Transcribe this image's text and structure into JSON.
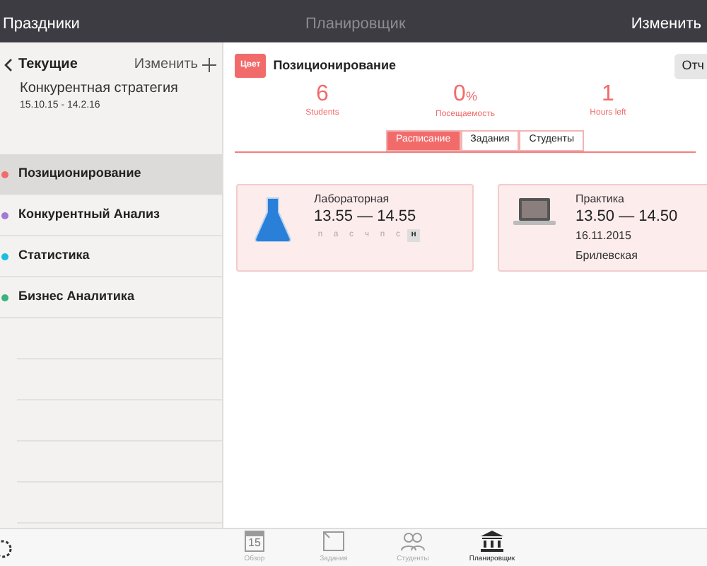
{
  "navbar": {
    "left": "Праздники",
    "title": "Планировщик",
    "right": "Изменить"
  },
  "sidebar": {
    "header": {
      "title": "Текущие",
      "edit": "Изменить",
      "name": "Конкурентная стратегия",
      "dates": "15.10.15 - 14.2.16"
    },
    "items": [
      {
        "label": "Позиционирование",
        "color": "#f26b6b",
        "selected": true
      },
      {
        "label": "Конкурентный Анализ",
        "color": "#a27ad6",
        "selected": false
      },
      {
        "label": "Статистика",
        "color": "#1bbde0",
        "selected": false
      },
      {
        "label": "Бизнес Аналитика",
        "color": "#3bb37e",
        "selected": false
      }
    ]
  },
  "detail": {
    "color_badge": "Цвет",
    "title": "Позиционирование",
    "report_button": "Отч",
    "stats": [
      {
        "value": "6",
        "label": "Students"
      },
      {
        "value": "0",
        "unit": "%",
        "label": "Посещаемость"
      },
      {
        "value": "1",
        "label": "Hours left"
      }
    ],
    "tabs": [
      {
        "label": "Расписание",
        "selected": true
      },
      {
        "label": "Задания",
        "selected": false
      },
      {
        "label": "Студенты",
        "selected": false
      }
    ],
    "cards": [
      {
        "kind": "lab",
        "type": "Лабораторная",
        "time": "13.55 — 14.55",
        "days": [
          {
            "label": "п",
            "selected": false
          },
          {
            "label": "а",
            "selected": false
          },
          {
            "label": "с",
            "selected": false
          },
          {
            "label": "ч",
            "selected": false
          },
          {
            "label": "п",
            "selected": false
          },
          {
            "label": "с",
            "selected": false
          },
          {
            "label": "н",
            "selected": true
          }
        ]
      },
      {
        "kind": "practice",
        "type": "Практика",
        "time": "13.50 — 14.50",
        "date": "16.11.2015",
        "teacher": "Брилевская"
      }
    ]
  },
  "tabbar": {
    "calendar_day": "15",
    "items": [
      {
        "kind": "calendar",
        "label": "Обзор",
        "selected": false
      },
      {
        "kind": "tasks",
        "label": "Задания",
        "selected": false
      },
      {
        "kind": "students",
        "label": "Студенты",
        "selected": false
      },
      {
        "kind": "planner",
        "label": "Планировщик",
        "selected": true
      }
    ]
  }
}
